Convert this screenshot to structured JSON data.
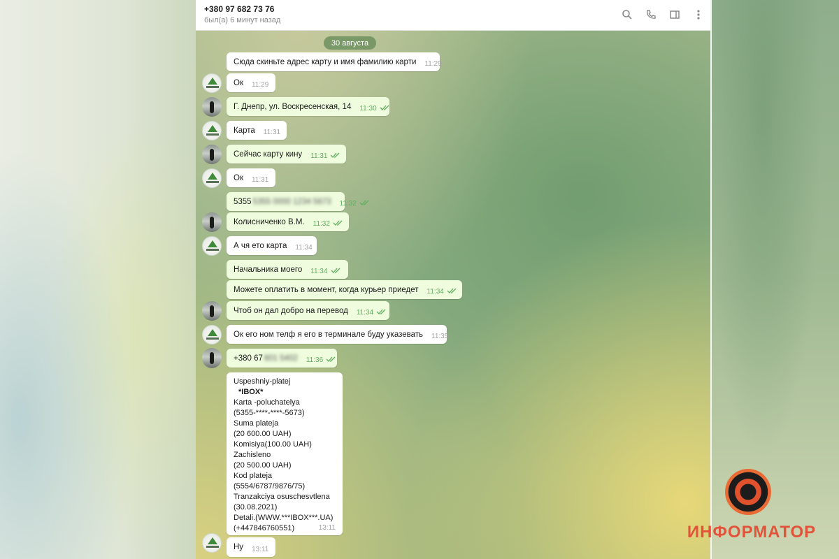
{
  "header": {
    "title": "+380 97 682 73 76",
    "status": "был(а) 6 минут назад",
    "icons": [
      "search-icon",
      "phone-icon",
      "sidebar-icon",
      "more-icon"
    ]
  },
  "date_separator": "30 августа",
  "messages": [
    {
      "dir": "in",
      "text": "Сюда скиньте адрес карту и имя фамилию карти",
      "time": "11:29",
      "avatar": "none"
    },
    {
      "dir": "in",
      "text": "Ок",
      "time": "11:29",
      "avatar": "shop"
    },
    {
      "dir": "out",
      "text": "Г. Днепр, ул. Воскресенская, 14",
      "time": "11:30",
      "avatar": "person"
    },
    {
      "dir": "in",
      "text": "Карта",
      "time": "11:31",
      "avatar": "shop"
    },
    {
      "dir": "out",
      "text": "Сейчас карту кину",
      "time": "11:31",
      "avatar": "person"
    },
    {
      "dir": "in",
      "text": "Ок",
      "time": "11:31",
      "avatar": "shop"
    },
    {
      "dir": "out",
      "text": "5355",
      "hidden": "5355 0000 1234 5673",
      "time": "11:32",
      "avatar": "none"
    },
    {
      "dir": "out",
      "text": "Колисниченко В.М.",
      "time": "11:32",
      "avatar": "person"
    },
    {
      "dir": "in",
      "text": "А чя ето карта",
      "time": "11:34",
      "avatar": "shop"
    },
    {
      "dir": "out",
      "text": "Начальника моего",
      "time": "11:34",
      "avatar": "none"
    },
    {
      "dir": "out",
      "text": "Можете оплатить в момент, когда курьер приедет",
      "time": "11:34",
      "avatar": "none"
    },
    {
      "dir": "out",
      "text": "Чтоб он дал добро на перевод",
      "time": "11:34",
      "avatar": "person"
    },
    {
      "dir": "in",
      "text": "Ок его ном телф я его в терминале буду указевать",
      "time": "11:35",
      "avatar": "shop"
    },
    {
      "dir": "out",
      "text": "+380 67",
      "hidden": "601 5402",
      "time": "11:36",
      "avatar": "person"
    }
  ],
  "receipt": {
    "lines": [
      "Uspeshniy-platej",
      "*IBOX*",
      "Karta -poluchatelya",
      "(5355-****-****-5673)",
      "Suma plateja",
      "(20 600.00 UAH)",
      "Komisiya(100.00 UAH)",
      "Zachisleno",
      "(20 500.00 UAH)",
      "Kod plateja",
      "(5554/6787/9876/75)",
      "Tranzakciya osuschesvtlena",
      "(30.08.2021)",
      "Detali.(WWW.***IBOX***.UA)",
      "(+447846760551)"
    ],
    "time": "13:11"
  },
  "last_message": {
    "dir": "in",
    "text": "Ну",
    "time": "13:11",
    "avatar": "shop"
  },
  "watermark": {
    "text": "ИНФОРМАТОР",
    "color": "#e1543a"
  }
}
